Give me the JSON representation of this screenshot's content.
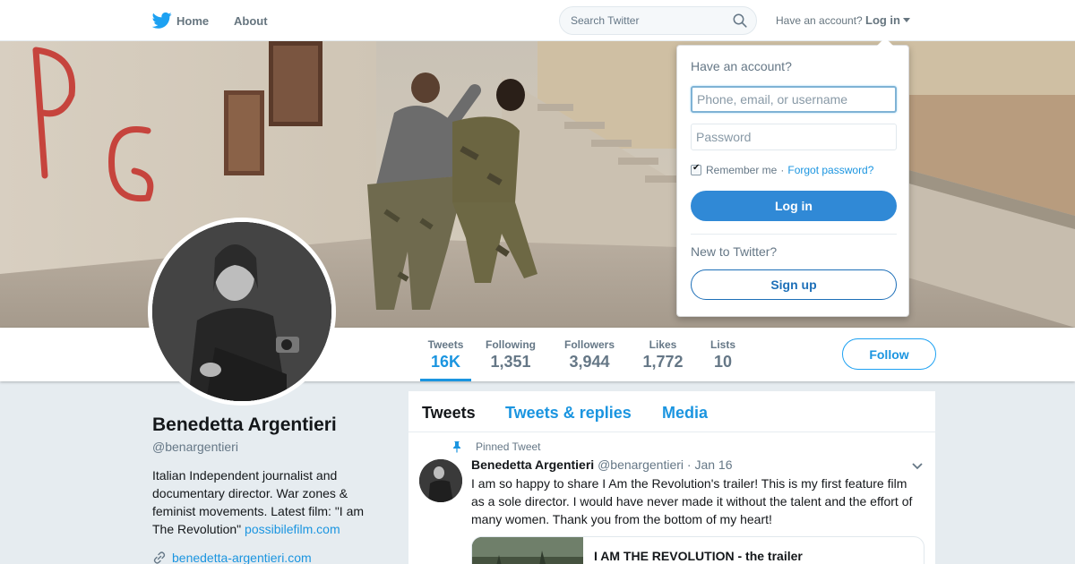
{
  "nav": {
    "home_label": "Home",
    "about_label": "About",
    "search_placeholder": "Search Twitter",
    "have_account": "Have an account?",
    "login_label": "Log in"
  },
  "profile": {
    "name": "Benedetta Argentieri",
    "handle": "@benargentieri",
    "bio_text": "Italian Independent journalist and documentary director. War zones & feminist movements. Latest film: \"I am The Revolution\" ",
    "bio_link": "possibilefilm.com",
    "website": "benedetta-argentieri.com"
  },
  "stats": [
    {
      "label": "Tweets",
      "value": "16K"
    },
    {
      "label": "Following",
      "value": "1,351"
    },
    {
      "label": "Followers",
      "value": "3,944"
    },
    {
      "label": "Likes",
      "value": "1,772"
    },
    {
      "label": "Lists",
      "value": "10"
    }
  ],
  "follow_label": "Follow",
  "timeline": {
    "tabs": [
      "Tweets",
      "Tweets & replies",
      "Media"
    ],
    "pinned_label": "Pinned Tweet",
    "tweet": {
      "name": "Benedetta Argentieri",
      "handle": "@benargentieri",
      "date": "· Jan 16",
      "text": "I am so happy to share I Am the Revolution's trailer! This is my first feature film as a sole director. I would have never made it without the talent and the effort of many women. Thank you from the bottom of my heart!",
      "card_title": "I AM THE REVOLUTION - the trailer"
    }
  },
  "login_dropdown": {
    "heading": "Have an account?",
    "username_placeholder": "Phone, email, or username",
    "password_placeholder": "Password",
    "remember_label": "Remember me",
    "separator": "·",
    "forgot_label": "Forgot password?",
    "login_button": "Log in",
    "new_label": "New to Twitter?",
    "signup_button": "Sign up"
  },
  "colors": {
    "accent": "#1b95e0",
    "login_button": "#3089d6",
    "background": "#e6ecf0"
  }
}
